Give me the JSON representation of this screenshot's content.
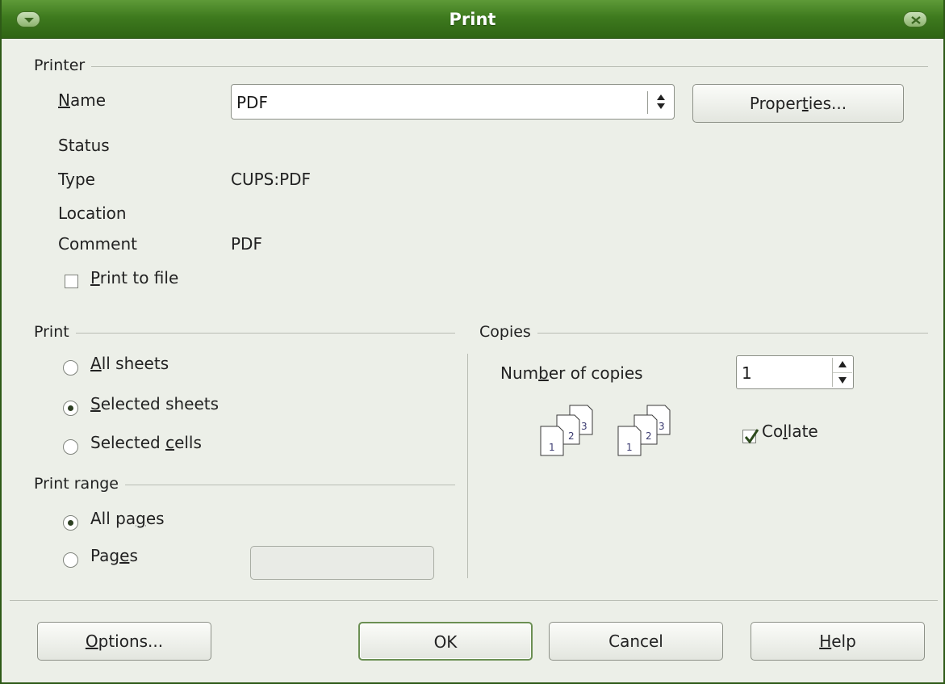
{
  "window": {
    "title": "Print"
  },
  "printer": {
    "section_label": "Printer",
    "name_label": "Name",
    "name_value": "PDF",
    "properties_button": "Properties...",
    "status_label": "Status",
    "status_value": "",
    "type_label": "Type",
    "type_value": "CUPS:PDF",
    "location_label": "Location",
    "location_value": "",
    "comment_label": "Comment",
    "comment_value": "PDF",
    "print_to_file_label": "Print to file",
    "print_to_file_checked": false
  },
  "print": {
    "section_label": "Print",
    "options": [
      {
        "label": "All sheets",
        "selected": false
      },
      {
        "label": "Selected sheets",
        "selected": true
      },
      {
        "label": "Selected cells",
        "selected": false
      }
    ]
  },
  "print_range": {
    "section_label": "Print range",
    "options": [
      {
        "label": "All pages",
        "selected": true
      },
      {
        "label": "Pages",
        "selected": false
      }
    ],
    "pages_value": ""
  },
  "copies": {
    "section_label": "Copies",
    "number_label": "Number of copies",
    "number_value": "1",
    "collate_label": "Collate",
    "collate_checked": true,
    "icon_digits": [
      "1",
      "2",
      "3"
    ]
  },
  "buttons": {
    "options": "Options...",
    "ok": "OK",
    "cancel": "Cancel",
    "help": "Help"
  },
  "icons": {
    "window_menu": "window-menu-icon",
    "window_close": "window-close-icon",
    "combo_arrow": "updown-arrow-icon",
    "copies_pages": "collate-pages-icon"
  },
  "colors": {
    "titlebar": "#3e7a1e",
    "dialog_bg": "#ecefe8",
    "check_mark": "#2c4a1c"
  }
}
